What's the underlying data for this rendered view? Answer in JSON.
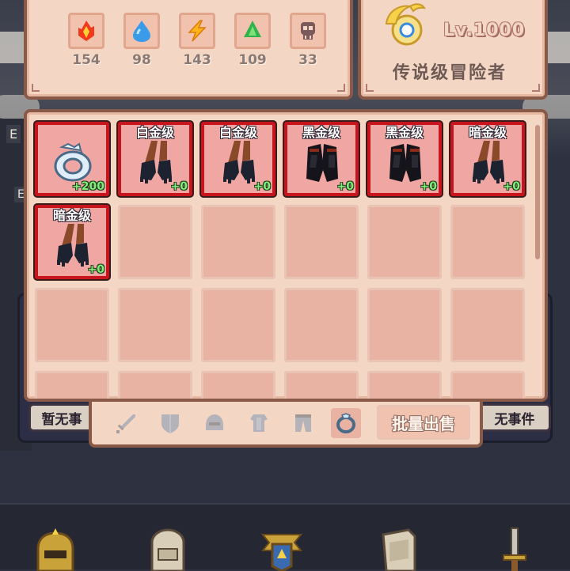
{
  "resources": [
    {
      "icon": "fire-gem-icon",
      "value": "154"
    },
    {
      "icon": "water-drop-icon",
      "value": "98"
    },
    {
      "icon": "lightning-icon",
      "value": "143"
    },
    {
      "icon": "leaf-gem-icon",
      "value": "109"
    },
    {
      "icon": "skull-icon",
      "value": "33"
    }
  ],
  "player": {
    "level": "Lv.1000",
    "rank": "传说级冒险者"
  },
  "inventory": {
    "items": [
      {
        "tier": "",
        "plus": "+200",
        "type": "ring"
      },
      {
        "tier": "白金级",
        "plus": "+0",
        "type": "gauntlets-dark"
      },
      {
        "tier": "白金级",
        "plus": "+0",
        "type": "gauntlets-dark"
      },
      {
        "tier": "黑金级",
        "plus": "+0",
        "type": "gauntlets-black"
      },
      {
        "tier": "黑金级",
        "plus": "+0",
        "type": "gauntlets-black"
      },
      {
        "tier": "暗金级",
        "plus": "+0",
        "type": "gauntlets-dark"
      },
      {
        "tier": "暗金级",
        "plus": "+0",
        "type": "gauntlets-dark"
      }
    ]
  },
  "tabs": [
    {
      "icon": "sword-icon",
      "active": false
    },
    {
      "icon": "shield-icon",
      "active": false
    },
    {
      "icon": "helmet-icon",
      "active": false
    },
    {
      "icon": "armor-icon",
      "active": false
    },
    {
      "icon": "pants-icon",
      "active": false
    },
    {
      "icon": "ring-icon",
      "active": true
    }
  ],
  "actions": {
    "bulk_sell": "批量出售"
  },
  "events": {
    "left": "暂无事",
    "right": "无事件"
  },
  "background": {
    "edge_text_1": "E",
    "edge_text_2": "E"
  },
  "colors": {
    "panel_bg": "#f4d6c4",
    "panel_border": "#8a5a48",
    "slot_empty": "#e8b3a2",
    "slot_item_border": "#c8141c",
    "plus_text": "#7ff07a"
  }
}
